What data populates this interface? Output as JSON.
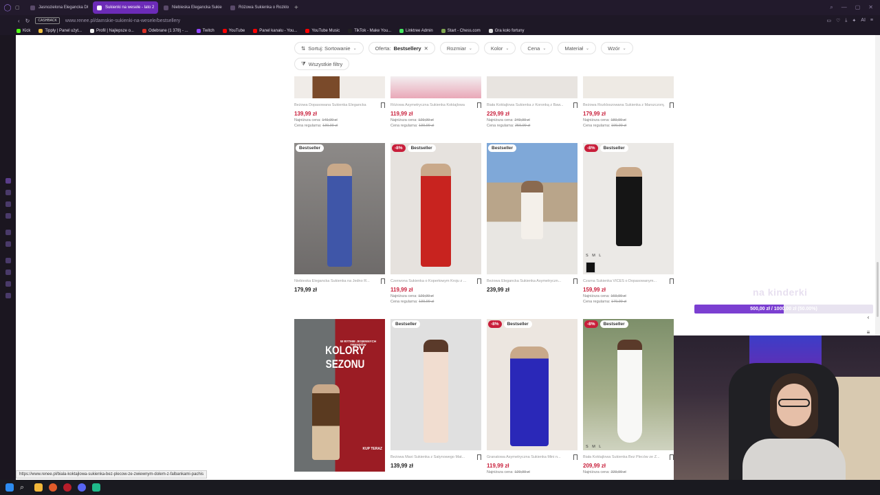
{
  "tabs": [
    {
      "label": "Jasnozielona Elegancka Dł",
      "active": false
    },
    {
      "label": "Sukienki na wesele - lato 2",
      "active": true
    },
    {
      "label": "Niebieska Elegancka Sukie",
      "active": false
    },
    {
      "label": "Różowa Sukienka o Rozklo",
      "active": false
    }
  ],
  "addressbar": {
    "cashback": "CASHBACK",
    "url": "www.renee.pl/damskie-sukienki-na-wesele/bestsellery"
  },
  "bookmarks": [
    {
      "label": "Kick",
      "color": "#53fc18"
    },
    {
      "label": "Tipply | Panel użyt...",
      "color": "#f0c040"
    },
    {
      "label": "Profil | Najlepsze o...",
      "color": "#eeeeee"
    },
    {
      "label": "Odebrane (1 378) - ...",
      "color": "#d93025"
    },
    {
      "label": "Twitch",
      "color": "#9146ff"
    },
    {
      "label": "YouTube",
      "color": "#ff0000"
    },
    {
      "label": "Panel kanału - You...",
      "color": "#ff0000"
    },
    {
      "label": "YouTube Music",
      "color": "#ff0000"
    },
    {
      "label": "TikTok - Make You...",
      "color": "#222222"
    },
    {
      "label": "Linktree Admin",
      "color": "#43e660"
    },
    {
      "label": "Start - Chess.com",
      "color": "#7fa650"
    },
    {
      "label": "Gra koło fortuny",
      "color": "#dddddd"
    }
  ],
  "filters": {
    "sort": "Sortuj: Sortowanie",
    "offer_prefix": "Oferta:",
    "offer_value": "Bestsellery",
    "size": "Rozmiar",
    "color": "Kolor",
    "price": "Cena",
    "material": "Materiał",
    "pattern": "Wzór",
    "all": "Wszystkie filtry"
  },
  "labels": {
    "bestseller": "Bestseller",
    "lowest_price": "Najniższa cena:",
    "regular_price": "Cena regularna:",
    "sizes": "S M L"
  },
  "row1": [
    {
      "title": "Beżowa Dopasowana Sukienka Elegancka",
      "price": "139,99 zł",
      "lowest": "149,99 zł",
      "regular": "139,99 zł"
    },
    {
      "title": "Różowa Asymetryczna Sukienka Koktajlowa",
      "price": "119,99 zł",
      "lowest": "129,99 zł",
      "regular": "139,99 zł"
    },
    {
      "title": "Biała Koktajlowa Sukienka z Koronką z Baw...",
      "price": "229,99 zł",
      "lowest": "249,99 zł",
      "regular": "259,99 zł"
    },
    {
      "title": "Beżowa Rozkloszowana Sukienka z Marszczonym...",
      "price": "179,99 zł",
      "lowest": "189,99 zł",
      "regular": "199,99 zł"
    }
  ],
  "row2": [
    {
      "title": "Niebieska Elegancka Sukienka na Jedno R...",
      "price": "179,99 zł",
      "sale": false,
      "discount": ""
    },
    {
      "title": "Czerwona Sukienka o Kopertowym Kroju z ...",
      "price": "119,99 zł",
      "sale": true,
      "discount": "-8%",
      "lowest": "129,99 zł",
      "regular": "139,99 zł"
    },
    {
      "title": "Beżowa Elegancka Sukienka Asymetryczn...",
      "price": "239,99 zł",
      "sale": false,
      "discount": ""
    },
    {
      "title": "Czarna Sukienka VICES o Dopasowanym...",
      "price": "159,99 zł",
      "sale": true,
      "discount": "-8%",
      "lowest": "169,99 zł",
      "regular": "179,99 zł"
    }
  ],
  "promo": {
    "line1": "W RYTMIE JESIENNYCH TRENDÓW",
    "headline": "KOLORY SEZONU",
    "cta": "KUP TERAZ"
  },
  "row3": [
    {
      "title": "Beżowa Maxi Sukienka z Satynowego Mat...",
      "price": "139,99 zł",
      "sale": false,
      "discount": ""
    },
    {
      "title": "Granatowa Asymetryczna Sukienka Mini n...",
      "price": "119,99 zł",
      "sale": true,
      "discount": "-8%",
      "lowest": "129,99 zł"
    },
    {
      "title": "Biała Koktajlowa Sukienka Bez Pleców ze Z...",
      "price": "209,99 zł",
      "sale": true,
      "discount": "-8%",
      "lowest": "229,99 zł"
    }
  ],
  "overlay": {
    "title": "na kinderki",
    "goal": "500,00 zł / 1000,00 zł (50.00%)",
    "progress": 0.5
  },
  "statusbar": "https://www.renee.pl/biala-koktajlowa-sukienka-bez-plecow-ze-zwiewnym-dolem-z-falbankami-pachis"
}
